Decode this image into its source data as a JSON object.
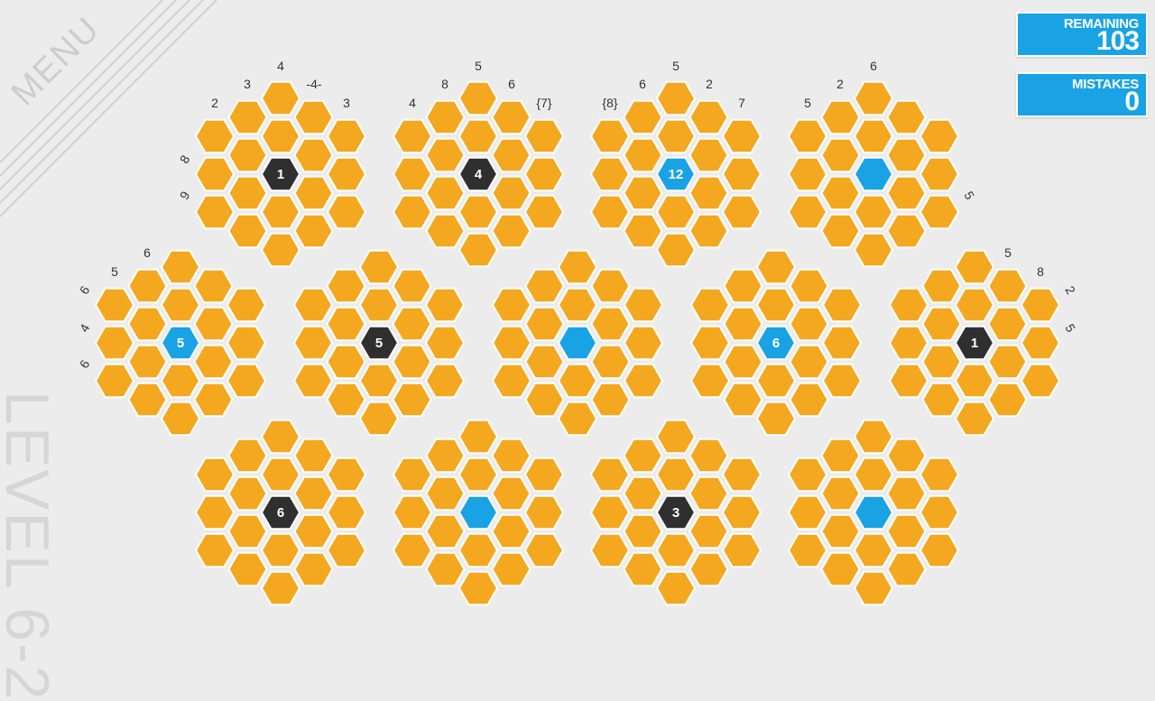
{
  "hud": {
    "menu_label": "MENU",
    "level_label": "LEVEL 6-2",
    "remaining_label": "REMAINING",
    "remaining_value": "103",
    "mistakes_label": "MISTAKES",
    "mistakes_value": "0"
  },
  "colors": {
    "background": "#ececec",
    "cell_unrevealed": "#f4a81f",
    "cell_revealed_dark": "#2f2f2f",
    "cell_revealed_blue": "#1aa3e4",
    "counter_bg": "#1aa3e4"
  },
  "boards": [
    {
      "center_kind": "dark",
      "center_text": "1",
      "clues": [
        {
          "t": "4",
          "d": "N"
        },
        {
          "t": "3",
          "d": "NNW"
        },
        {
          "t": "2",
          "d": "NW"
        },
        {
          "t": "-4-",
          "d": "NNE"
        },
        {
          "t": "3",
          "d": "NE"
        },
        {
          "t": "8",
          "d": "W1"
        },
        {
          "t": "9",
          "d": "W2"
        }
      ]
    },
    {
      "center_kind": "dark",
      "center_text": "4",
      "clues": [
        {
          "t": "5",
          "d": "N"
        },
        {
          "t": "8",
          "d": "NNW"
        },
        {
          "t": "4",
          "d": "NW"
        },
        {
          "t": "6",
          "d": "NNE"
        },
        {
          "t": "{7}",
          "d": "NE"
        }
      ]
    },
    {
      "center_kind": "blue",
      "center_text": "12",
      "clues": [
        {
          "t": "5",
          "d": "N"
        },
        {
          "t": "6",
          "d": "NNW"
        },
        {
          "t": "{8}",
          "d": "NW"
        },
        {
          "t": "2",
          "d": "NNE"
        },
        {
          "t": "7",
          "d": "NE"
        }
      ]
    },
    {
      "center_kind": "blue",
      "center_text": "",
      "clues": [
        {
          "t": "6",
          "d": "N"
        },
        {
          "t": "2",
          "d": "NNW"
        },
        {
          "t": "5",
          "d": "NW"
        },
        {
          "t": "5",
          "d": "E2"
        }
      ]
    },
    {
      "center_kind": "blue",
      "center_text": "5",
      "clues": [
        {
          "t": "6",
          "d": "NNW"
        },
        {
          "t": "5",
          "d": "NW"
        },
        {
          "t": "6",
          "d": "W0"
        },
        {
          "t": "4",
          "d": "W1"
        },
        {
          "t": "6",
          "d": "W2"
        }
      ]
    },
    {
      "center_kind": "dark",
      "center_text": "5",
      "clues": []
    },
    {
      "center_kind": "blue",
      "center_text": "",
      "clues": []
    },
    {
      "center_kind": "blue",
      "center_text": "6",
      "clues": []
    },
    {
      "center_kind": "dark",
      "center_text": "1",
      "clues": [
        {
          "t": "5",
          "d": "NNE"
        },
        {
          "t": "8",
          "d": "NE"
        },
        {
          "t": "2",
          "d": "E0"
        },
        {
          "t": "5",
          "d": "E1"
        }
      ]
    },
    {
      "center_kind": "dark",
      "center_text": "6",
      "clues": []
    },
    {
      "center_kind": "blue",
      "center_text": "",
      "clues": []
    },
    {
      "center_kind": "dark",
      "center_text": "3",
      "clues": []
    },
    {
      "center_kind": "blue",
      "center_text": "",
      "clues": []
    }
  ]
}
